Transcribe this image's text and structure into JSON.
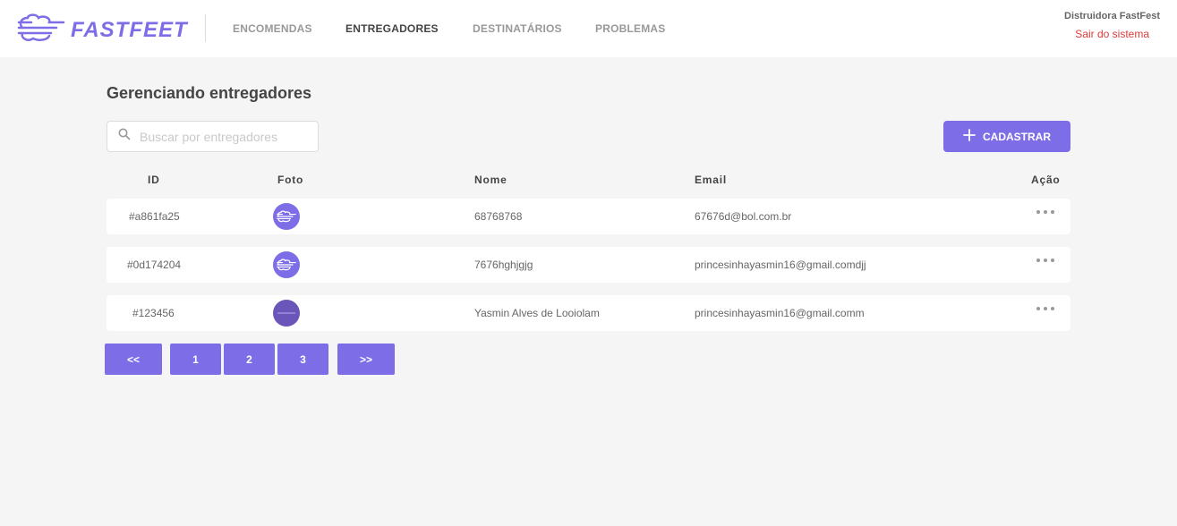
{
  "brand": {
    "name": "FASTFEET",
    "color": "#7d6ee7"
  },
  "nav": [
    {
      "label": "ENCOMENDAS",
      "active": false
    },
    {
      "label": "ENTREGADORES",
      "active": true
    },
    {
      "label": "DESTINATÁRIOS",
      "active": false
    },
    {
      "label": "PROBLEMAS",
      "active": false
    }
  ],
  "user": {
    "name": "Distruidora FastFest",
    "logout_label": "Sair do sistema"
  },
  "page": {
    "title": "Gerenciando entregadores"
  },
  "search": {
    "placeholder": "Buscar por entregadores",
    "value": ""
  },
  "toolbar": {
    "add_label": "CADASTRAR"
  },
  "table": {
    "columns": [
      "ID",
      "Foto",
      "Nome",
      "Email",
      "Ação"
    ],
    "rows": [
      {
        "id": "#a861fa25",
        "nome": "68768768",
        "email": "67676d@bol.com.br",
        "avatar": "logo-avatar"
      },
      {
        "id": "#0d174204",
        "nome": "7676hghjgjg",
        "email": "princesinhayasmin16@gmail.comdjj",
        "avatar": "logo-avatar"
      },
      {
        "id": "#123456",
        "nome": "Yasmin Alves de Looiolam",
        "email": "princesinhayasmin16@gmail.comm",
        "avatar": "photo-avatar"
      }
    ]
  },
  "pagination": {
    "prev": "<<",
    "pages": [
      "1",
      "2",
      "3"
    ],
    "next": ">>"
  },
  "colors": {
    "accent": "#7d6ee7",
    "danger": "#de3b3b",
    "background": "#f5f5f5"
  }
}
